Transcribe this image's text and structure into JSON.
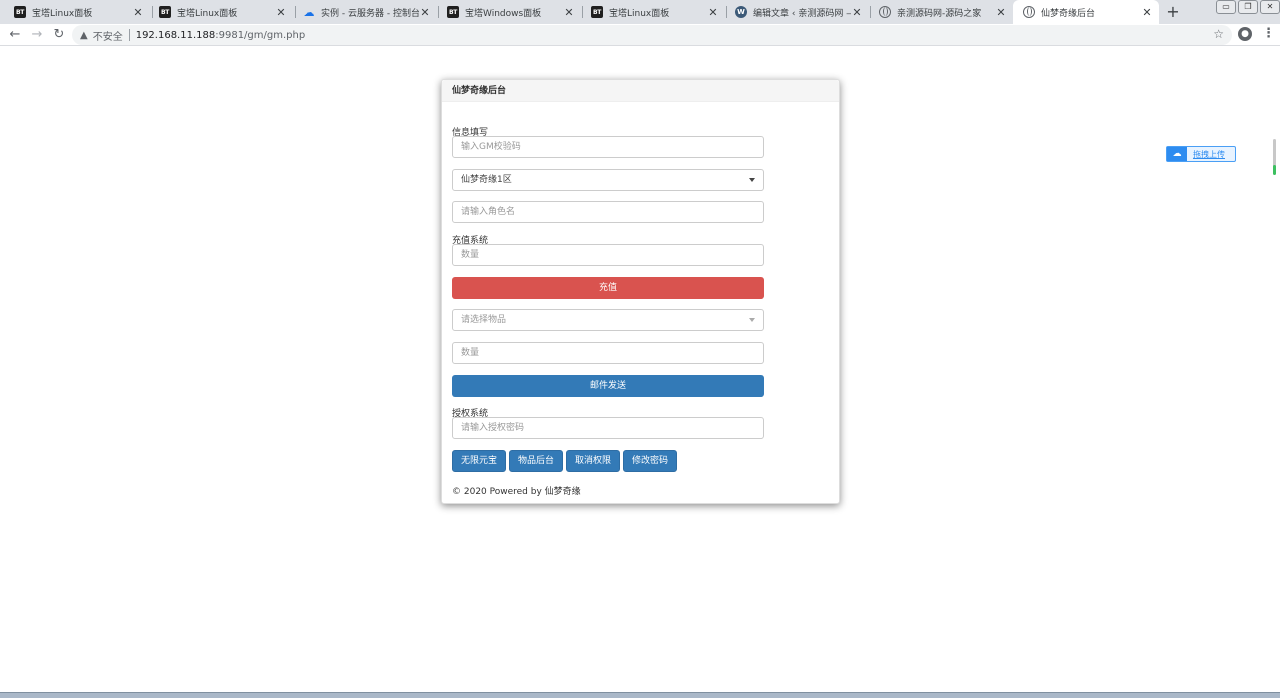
{
  "browser": {
    "tabs": [
      {
        "title": "宝塔Linux面板",
        "icon": "bt-icon",
        "active": false
      },
      {
        "title": "宝塔Linux面板",
        "icon": "bt-icon",
        "active": false
      },
      {
        "title": "实例 - 云服务器 - 控制台",
        "icon": "cloud-icon",
        "active": false
      },
      {
        "title": "宝塔Windows面板",
        "icon": "bt-icon",
        "active": false
      },
      {
        "title": "宝塔Linux面板",
        "icon": "bt-icon",
        "active": false
      },
      {
        "title": "编辑文章 ‹ 亲测源码网 — W",
        "icon": "wordpress-icon",
        "active": false
      },
      {
        "title": "亲测源码网-源码之家",
        "icon": "globe-icon",
        "active": false
      },
      {
        "title": "仙梦奇缘后台",
        "icon": "globe-icon",
        "active": true
      }
    ],
    "new_tab": "+",
    "address": {
      "security_label": "不安全",
      "host": "192.168.11.188",
      "path": ":9981/gm/gm.php"
    }
  },
  "panel": {
    "title": "仙梦奇缘后台",
    "info_section_label": "信息填写",
    "gm_code_placeholder": "输入GM校验码",
    "server_select_value": "仙梦奇缘1区",
    "role_name_placeholder": "请输入角色名",
    "recharge_section_label": "充值系统",
    "recharge_amount_placeholder": "数量",
    "recharge_button": "充值",
    "item_select_placeholder": "请选择物品",
    "item_amount_placeholder": "数量",
    "mail_send_button": "邮件发送",
    "auth_section_label": "授权系统",
    "auth_password_placeholder": "请输入授权密码",
    "action_buttons": [
      "无限元宝",
      "物品后台",
      "取消权限",
      "修改密码"
    ],
    "footer": "© 2020 Powered by 仙梦奇缘"
  },
  "side_widget": {
    "label": "拖拽上传",
    "icon": "cloud-upload-icon"
  },
  "colors": {
    "danger": "#d9534f",
    "primary": "#337ab7"
  }
}
